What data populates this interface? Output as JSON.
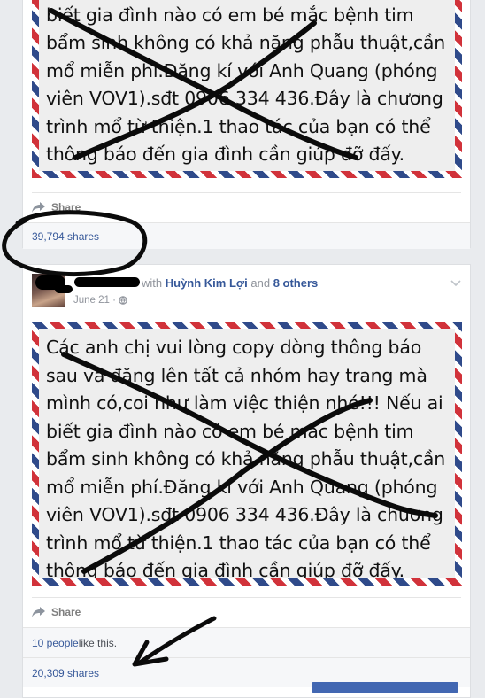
{
  "post1": {
    "notice_text": "mình có,coi như làm việc thiện nhé!!! Nếu ai\nbiết gia đình nào có em bé mắc bệnh tim\nbẩm sinh không có khả năng phẫu thuật,cần\nmổ miễn phí.Đăng kí với Anh Quang (phóng\nviên VOV1).sđt 0906 334 436.Đây là chương\ntrình mổ từ thiện.1 thao tác của bạn có thể\nthông báo đến gia đình cần giúp đỡ đấy.",
    "share_label": "Share",
    "shares_count": "39,794 shares"
  },
  "post2": {
    "with_prefix": "with ",
    "with_name": "Huỳnh Kim Lợi",
    "with_and": " and ",
    "with_others": "8 others",
    "date": "June 21 · ",
    "notice_text": "Các anh chị vui lòng copy dòng thông báo\nsau và đăng lên tất cả nhóm hay trang mà\nmình có,coi như làm việc thiện nhé!!! Nếu ai\nbiết gia đình nào có em bé mắc bệnh tim\nbẩm sinh không có khả năng phẫu thuật,cần\nmổ miễn phí.Đăng kí với Anh Quang (phóng\nviên VOV1).sđt 0906 334 436.Đây là chương\ntrình mổ từ thiện.1 thao tác của bạn có thể\nthông báo đến gia đình cần giúp đỡ đấy.",
    "share_label": "Share",
    "likes_people": "10 people",
    "likes_suffix": " like this.",
    "shares_count": "20,309 shares"
  },
  "colors": {
    "link": "#365899",
    "page_bg": "#e9ebee",
    "airmail_red": "#d1323a",
    "airmail_blue": "#2f4a8a"
  },
  "icons": [
    "share-arrow-icon",
    "globe-icon",
    "chevron-down-icon"
  ]
}
